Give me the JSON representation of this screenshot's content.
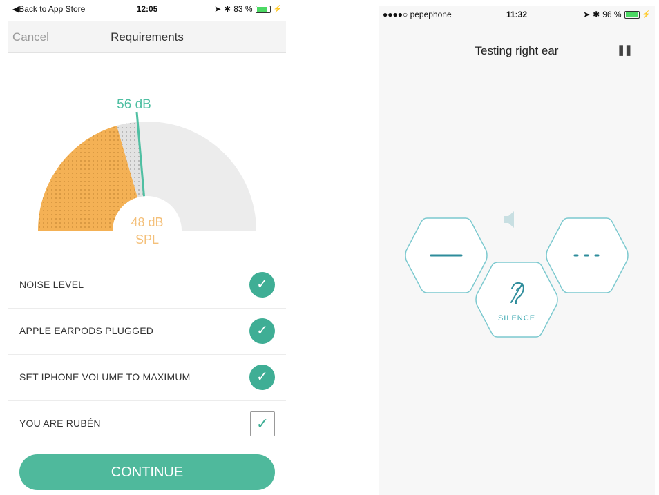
{
  "left_screen": {
    "status": {
      "carrier": "◀Back to App Store",
      "time": "12:05",
      "battery": "83 %",
      "battery_level": 0.83
    },
    "nav": {
      "cancel": "Cancel",
      "title": "Requirements"
    },
    "gauge": {
      "needle_value": "56 dB",
      "center_value": "48 dB",
      "center_unit": "SPL"
    },
    "requirements": [
      {
        "label": "NOISE LEVEL",
        "checked": true
      },
      {
        "label": "APPLE EARPODS PLUGGED",
        "checked": true
      },
      {
        "label": "SET IPHONE VOLUME TO MAXIMUM",
        "checked": true
      },
      {
        "label": "YOU ARE RUBÉN",
        "checked": true
      }
    ],
    "continue_label": "CONTINUE"
  },
  "right_screen": {
    "status": {
      "carrier": "●●●●○ pepephone",
      "time": "11:32",
      "battery": "96 %",
      "battery_level": 0.96
    },
    "title": "Testing right ear",
    "pause_icon": "pause-icon",
    "buttons": {
      "long": "long-tone",
      "short": "short-tones",
      "silence": "SILENCE"
    }
  },
  "colors": {
    "accent": "#3fae95",
    "orange": "#f4b155",
    "teal_outline": "#6cc3c9",
    "gauge_bg": "#ececec"
  }
}
